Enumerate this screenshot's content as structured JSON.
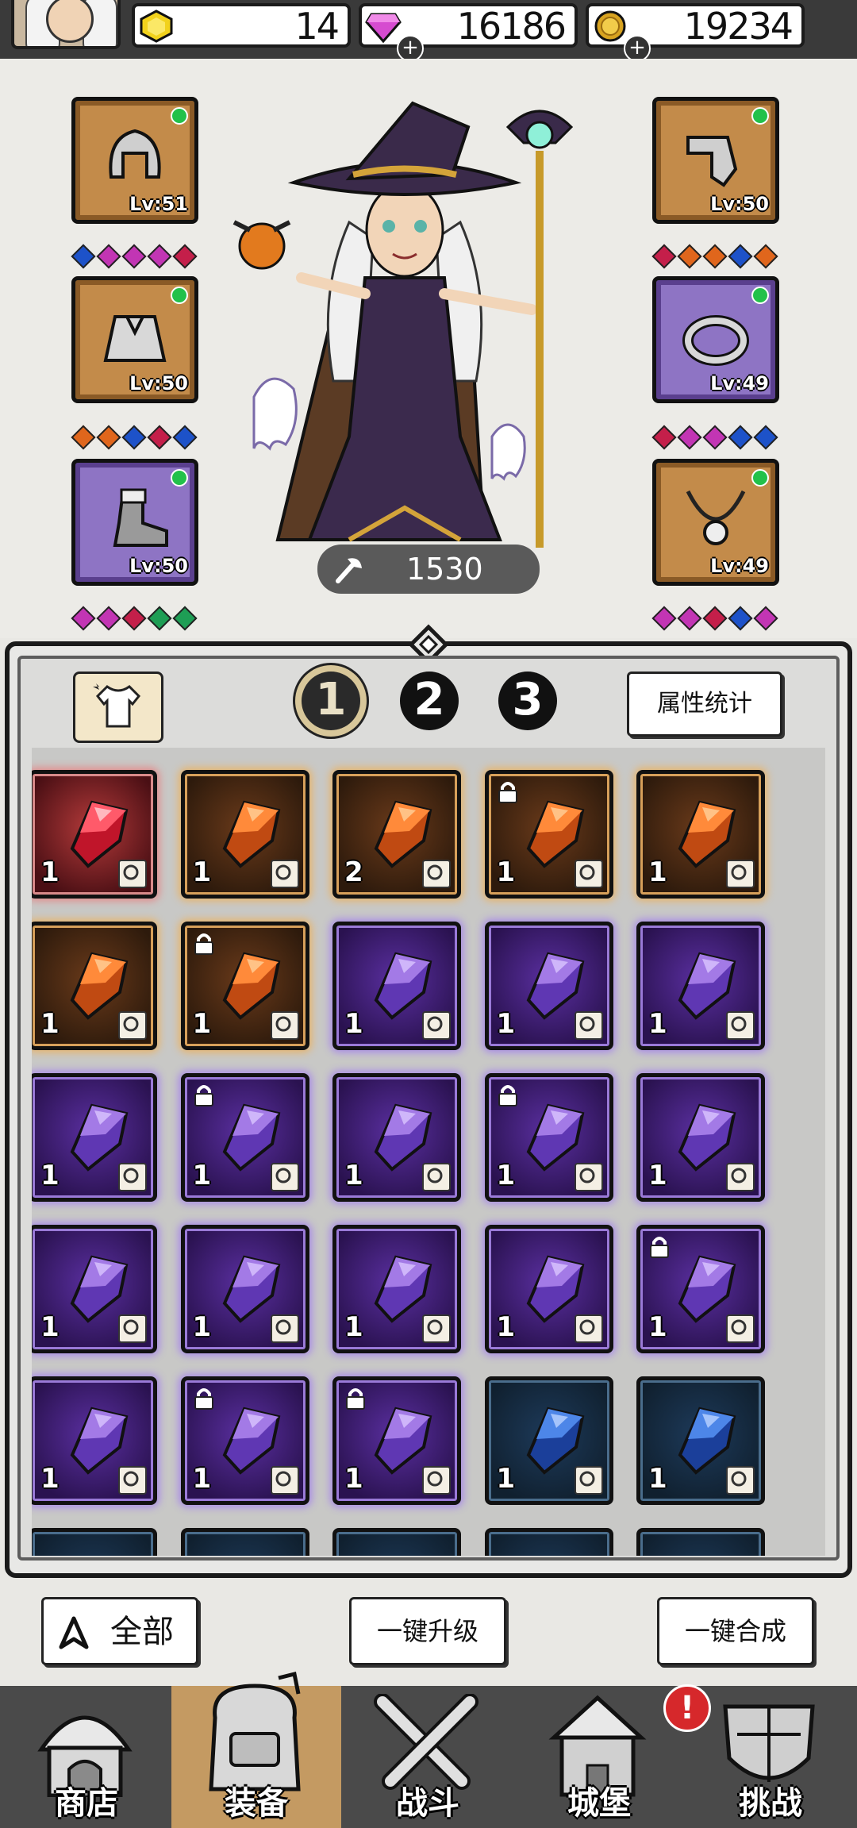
{
  "resources": {
    "topaz": {
      "value": "14",
      "icon": "yellow-hexagon-gem-icon"
    },
    "diamonds": {
      "value": "16186",
      "icon": "pink-diamond-icon",
      "plus": "+"
    },
    "gold": {
      "value": "19234",
      "icon": "gold-coin-icon",
      "plus": "+"
    }
  },
  "equipment": {
    "left": [
      {
        "name": "helmet",
        "level": "Lv:51",
        "rarity": "brown",
        "gems": [
          "#1d52c9",
          "#c235b4",
          "#c235b4",
          "#c235b4",
          "#c41f4a"
        ]
      },
      {
        "name": "armor",
        "level": "Lv:50",
        "rarity": "brown",
        "gems": [
          "#e0661c",
          "#e0661c",
          "#1d52c9",
          "#c41f4a",
          "#1d52c9"
        ]
      },
      {
        "name": "boots",
        "level": "Lv:50",
        "rarity": "purple",
        "gems": [
          "#c235b4",
          "#c235b4",
          "#c41f4a",
          "#1e9e55",
          "#1e9e55"
        ]
      }
    ],
    "right": [
      {
        "name": "gloves",
        "level": "Lv:50",
        "rarity": "brown",
        "gems": [
          "#c41f4a",
          "#e0661c",
          "#e0661c",
          "#1d52c9",
          "#e0661c"
        ]
      },
      {
        "name": "ring",
        "level": "Lv:49",
        "rarity": "purple",
        "gems": [
          "#c41f4a",
          "#c235b4",
          "#c235b4",
          "#1d52c9",
          "#1d52c9"
        ]
      },
      {
        "name": "necklace",
        "level": "Lv:49",
        "rarity": "brown",
        "gems": [
          "#c235b4",
          "#c235b4",
          "#c41f4a",
          "#1d52c9",
          "#c235b4"
        ]
      }
    ]
  },
  "hero": {
    "power": "1530"
  },
  "tabs": [
    "1",
    "2",
    "3"
  ],
  "selected_tab": "1",
  "stats_button": "属性统计",
  "inventory": [
    {
      "rarity": "red",
      "count": "1",
      "slot": "armor",
      "locked": false
    },
    {
      "rarity": "orange",
      "count": "1",
      "slot": "armor",
      "locked": false
    },
    {
      "rarity": "orange",
      "count": "2",
      "slot": "boots",
      "locked": false
    },
    {
      "rarity": "orange",
      "count": "1",
      "slot": "ring",
      "locked": true
    },
    {
      "rarity": "orange",
      "count": "1",
      "slot": "necklace",
      "locked": false
    },
    {
      "rarity": "orange",
      "count": "1",
      "slot": "necklace",
      "locked": false
    },
    {
      "rarity": "orange",
      "count": "1",
      "slot": "necklace",
      "locked": true
    },
    {
      "rarity": "purple",
      "count": "1",
      "slot": "armor",
      "locked": false
    },
    {
      "rarity": "purple",
      "count": "1",
      "slot": "armor",
      "locked": false
    },
    {
      "rarity": "purple",
      "count": "1",
      "slot": "cape",
      "locked": false
    },
    {
      "rarity": "purple",
      "count": "1",
      "slot": "cape",
      "locked": false
    },
    {
      "rarity": "purple",
      "count": "1",
      "slot": "cape",
      "locked": true
    },
    {
      "rarity": "purple",
      "count": "1",
      "slot": "cape",
      "locked": false
    },
    {
      "rarity": "purple",
      "count": "1",
      "slot": "boots",
      "locked": true
    },
    {
      "rarity": "purple",
      "count": "1",
      "slot": "gloves",
      "locked": false
    },
    {
      "rarity": "purple",
      "count": "1",
      "slot": "gloves",
      "locked": false
    },
    {
      "rarity": "purple",
      "count": "1",
      "slot": "ring",
      "locked": false
    },
    {
      "rarity": "purple",
      "count": "1",
      "slot": "ring",
      "locked": false
    },
    {
      "rarity": "purple",
      "count": "1",
      "slot": "ring",
      "locked": false
    },
    {
      "rarity": "purple",
      "count": "1",
      "slot": "ring",
      "locked": true
    },
    {
      "rarity": "purple",
      "count": "1",
      "slot": "necklace",
      "locked": false
    },
    {
      "rarity": "purple",
      "count": "1",
      "slot": "necklace",
      "locked": true
    },
    {
      "rarity": "purple",
      "count": "1",
      "slot": "necklace",
      "locked": true
    },
    {
      "rarity": "blue",
      "count": "1",
      "slot": "armor",
      "locked": false
    },
    {
      "rarity": "blue",
      "count": "1",
      "slot": "armor",
      "locked": false
    },
    {
      "rarity": "blue",
      "count": "",
      "slot": "",
      "locked": false
    },
    {
      "rarity": "blue",
      "count": "",
      "slot": "",
      "locked": false
    },
    {
      "rarity": "blue",
      "count": "",
      "slot": "",
      "locked": false
    },
    {
      "rarity": "blue",
      "count": "",
      "slot": "",
      "locked": false
    },
    {
      "rarity": "blue",
      "count": "",
      "slot": "",
      "locked": false
    }
  ],
  "actions": {
    "filter_all": "全部",
    "one_click_upgrade": "一键升级",
    "one_click_merge": "一键合成"
  },
  "nav": [
    {
      "label": "商店",
      "icon": "shop-hut-icon"
    },
    {
      "label": "装备",
      "icon": "backpack-icon",
      "selected": true
    },
    {
      "label": "战斗",
      "icon": "crossed-swords-icon"
    },
    {
      "label": "城堡",
      "icon": "castle-icon",
      "badge": "!"
    },
    {
      "label": "挑战",
      "icon": "shield-crest-icon"
    }
  ],
  "colors": {
    "red_glow": "#e48b8b",
    "orange_glow": "#e8b46a",
    "purple_glow": "#a88ae8",
    "nav_selected": "#c49a62"
  }
}
